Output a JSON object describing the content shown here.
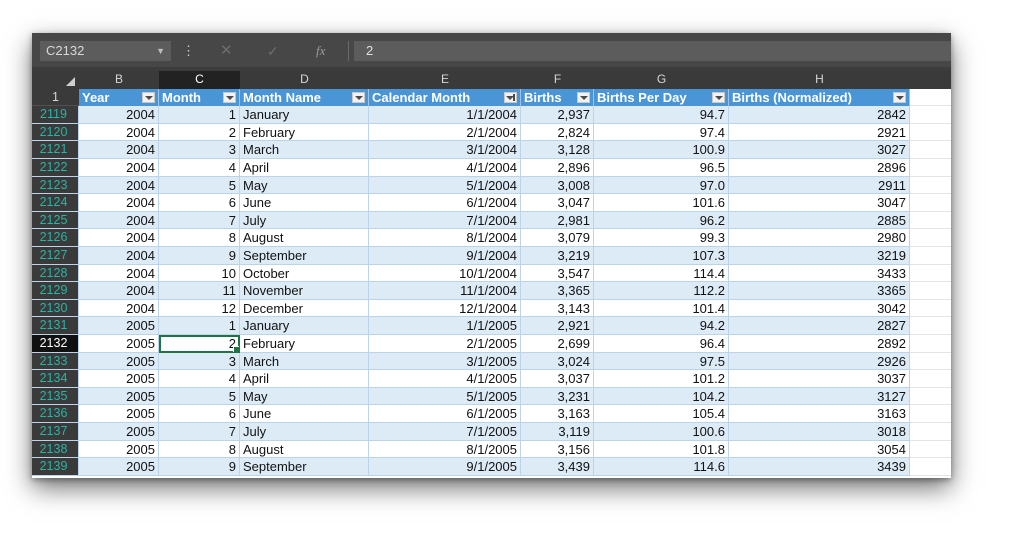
{
  "formula_bar": {
    "name_box": "C2132",
    "fx_label": "fx",
    "formula_value": "2"
  },
  "columns": [
    {
      "letter": "B",
      "field": "Year"
    },
    {
      "letter": "C",
      "field": "Month"
    },
    {
      "letter": "D",
      "field": "Month Name"
    },
    {
      "letter": "E",
      "field": "Calendar Month"
    },
    {
      "letter": "F",
      "field": "Births"
    },
    {
      "letter": "G",
      "field": "Births Per Day"
    },
    {
      "letter": "H",
      "field": "Births (Normalized)"
    }
  ],
  "header_row_number": "1",
  "selected_column": "C",
  "selected_row": "2132",
  "sorted_column": "E",
  "rows": [
    {
      "num": "2119",
      "year": "2004",
      "month": "1",
      "name": "January",
      "cal": "1/1/2004",
      "births": "2,937",
      "bpd": "94.7",
      "norm": "2842"
    },
    {
      "num": "2120",
      "year": "2004",
      "month": "2",
      "name": "February",
      "cal": "2/1/2004",
      "births": "2,824",
      "bpd": "97.4",
      "norm": "2921"
    },
    {
      "num": "2121",
      "year": "2004",
      "month": "3",
      "name": "March",
      "cal": "3/1/2004",
      "births": "3,128",
      "bpd": "100.9",
      "norm": "3027"
    },
    {
      "num": "2122",
      "year": "2004",
      "month": "4",
      "name": "April",
      "cal": "4/1/2004",
      "births": "2,896",
      "bpd": "96.5",
      "norm": "2896"
    },
    {
      "num": "2123",
      "year": "2004",
      "month": "5",
      "name": "May",
      "cal": "5/1/2004",
      "births": "3,008",
      "bpd": "97.0",
      "norm": "2911"
    },
    {
      "num": "2124",
      "year": "2004",
      "month": "6",
      "name": "June",
      "cal": "6/1/2004",
      "births": "3,047",
      "bpd": "101.6",
      "norm": "3047"
    },
    {
      "num": "2125",
      "year": "2004",
      "month": "7",
      "name": "July",
      "cal": "7/1/2004",
      "births": "2,981",
      "bpd": "96.2",
      "norm": "2885"
    },
    {
      "num": "2126",
      "year": "2004",
      "month": "8",
      "name": "August",
      "cal": "8/1/2004",
      "births": "3,079",
      "bpd": "99.3",
      "norm": "2980"
    },
    {
      "num": "2127",
      "year": "2004",
      "month": "9",
      "name": "September",
      "cal": "9/1/2004",
      "births": "3,219",
      "bpd": "107.3",
      "norm": "3219"
    },
    {
      "num": "2128",
      "year": "2004",
      "month": "10",
      "name": "October",
      "cal": "10/1/2004",
      "births": "3,547",
      "bpd": "114.4",
      "norm": "3433"
    },
    {
      "num": "2129",
      "year": "2004",
      "month": "11",
      "name": "November",
      "cal": "11/1/2004",
      "births": "3,365",
      "bpd": "112.2",
      "norm": "3365"
    },
    {
      "num": "2130",
      "year": "2004",
      "month": "12",
      "name": "December",
      "cal": "12/1/2004",
      "births": "3,143",
      "bpd": "101.4",
      "norm": "3042"
    },
    {
      "num": "2131",
      "year": "2005",
      "month": "1",
      "name": "January",
      "cal": "1/1/2005",
      "births": "2,921",
      "bpd": "94.2",
      "norm": "2827"
    },
    {
      "num": "2132",
      "year": "2005",
      "month": "2",
      "name": "February",
      "cal": "2/1/2005",
      "births": "2,699",
      "bpd": "96.4",
      "norm": "2892"
    },
    {
      "num": "2133",
      "year": "2005",
      "month": "3",
      "name": "March",
      "cal": "3/1/2005",
      "births": "3,024",
      "bpd": "97.5",
      "norm": "2926"
    },
    {
      "num": "2134",
      "year": "2005",
      "month": "4",
      "name": "April",
      "cal": "4/1/2005",
      "births": "3,037",
      "bpd": "101.2",
      "norm": "3037"
    },
    {
      "num": "2135",
      "year": "2005",
      "month": "5",
      "name": "May",
      "cal": "5/1/2005",
      "births": "3,231",
      "bpd": "104.2",
      "norm": "3127"
    },
    {
      "num": "2136",
      "year": "2005",
      "month": "6",
      "name": "June",
      "cal": "6/1/2005",
      "births": "3,163",
      "bpd": "105.4",
      "norm": "3163"
    },
    {
      "num": "2137",
      "year": "2005",
      "month": "7",
      "name": "July",
      "cal": "7/1/2005",
      "births": "3,119",
      "bpd": "100.6",
      "norm": "3018"
    },
    {
      "num": "2138",
      "year": "2005",
      "month": "8",
      "name": "August",
      "cal": "8/1/2005",
      "births": "3,156",
      "bpd": "101.8",
      "norm": "3054"
    },
    {
      "num": "2139",
      "year": "2005",
      "month": "9",
      "name": "September",
      "cal": "9/1/2005",
      "births": "3,439",
      "bpd": "114.6",
      "norm": "3439"
    }
  ],
  "colors": {
    "table_header": "#4a95d6",
    "band_row": "#ddebf7",
    "row_number_text": "#2bb3a6",
    "active_cell_border": "#217346"
  }
}
